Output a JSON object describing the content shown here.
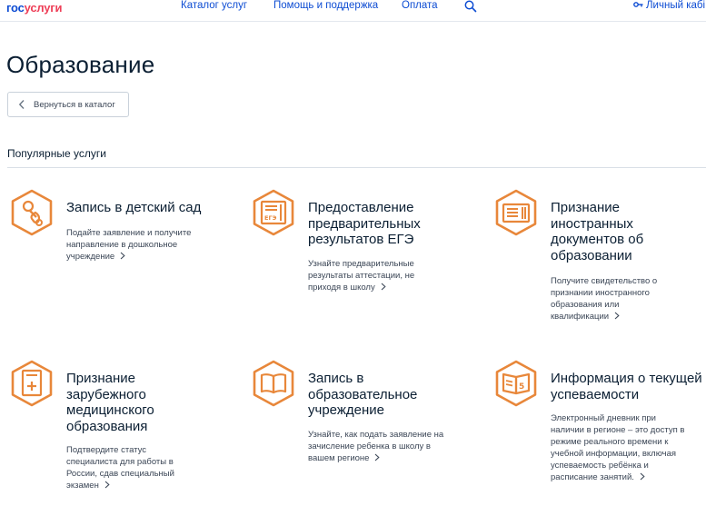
{
  "header": {
    "logo_gos": "гос",
    "logo_uslugi": "услуги",
    "nav": [
      "Каталог услуг",
      "Помощь и поддержка",
      "Оплата"
    ],
    "account": "Личный кабі"
  },
  "page": {
    "title": "Образование",
    "back_label": "Вернуться в каталог",
    "section_title": "Популярные услуги"
  },
  "cards": [
    {
      "title_lines": [
        "Запись в детский сад"
      ],
      "desc_lines": [
        "Подайте заявление и получите",
        "направление в дошкольное",
        "учреждение"
      ],
      "icon": "pacifier-icon"
    },
    {
      "title_lines": [
        "Предоставление",
        "предварительных",
        "результатов ЕГЭ"
      ],
      "desc_lines": [
        "Узнайте предварительные",
        "результаты аттестации, не",
        "приходя в школу"
      ],
      "icon": "ege-document-icon"
    },
    {
      "title_lines": [
        "Признание",
        "иностранных",
        "документов об",
        "образовании"
      ],
      "desc_lines": [
        "Получите свидетельство о",
        "признании иностранного",
        "образования или",
        "квалификации"
      ],
      "icon": "diploma-icon"
    },
    {
      "title_lines": [
        "Признание",
        "зарубежного",
        "медицинского",
        "образования"
      ],
      "desc_lines": [
        "Подтвердите статус",
        "специалиста для работы в",
        "России, сдав специальный",
        "экзамен"
      ],
      "icon": "medical-document-icon"
    },
    {
      "title_lines": [
        "Запись в",
        "образовательное",
        "учреждение"
      ],
      "desc_lines": [
        "Узнайте, как подать заявление на",
        "зачисление ребенка в школу в",
        "вашем регионе"
      ],
      "icon": "book-icon"
    },
    {
      "title_lines": [
        "Информация о текущей",
        "успеваемости"
      ],
      "desc_lines": [
        "Электронный дневник при",
        "наличии в регионе – это доступ в",
        "режиме реального времени к",
        "учебной информации, включая",
        "успеваемость ребёнка и",
        "расписание занятий."
      ],
      "icon": "diary-icon"
    }
  ],
  "colors": {
    "accent": "#e8873a",
    "link": "#0d4cd3",
    "logo_red": "#ee3f58"
  }
}
